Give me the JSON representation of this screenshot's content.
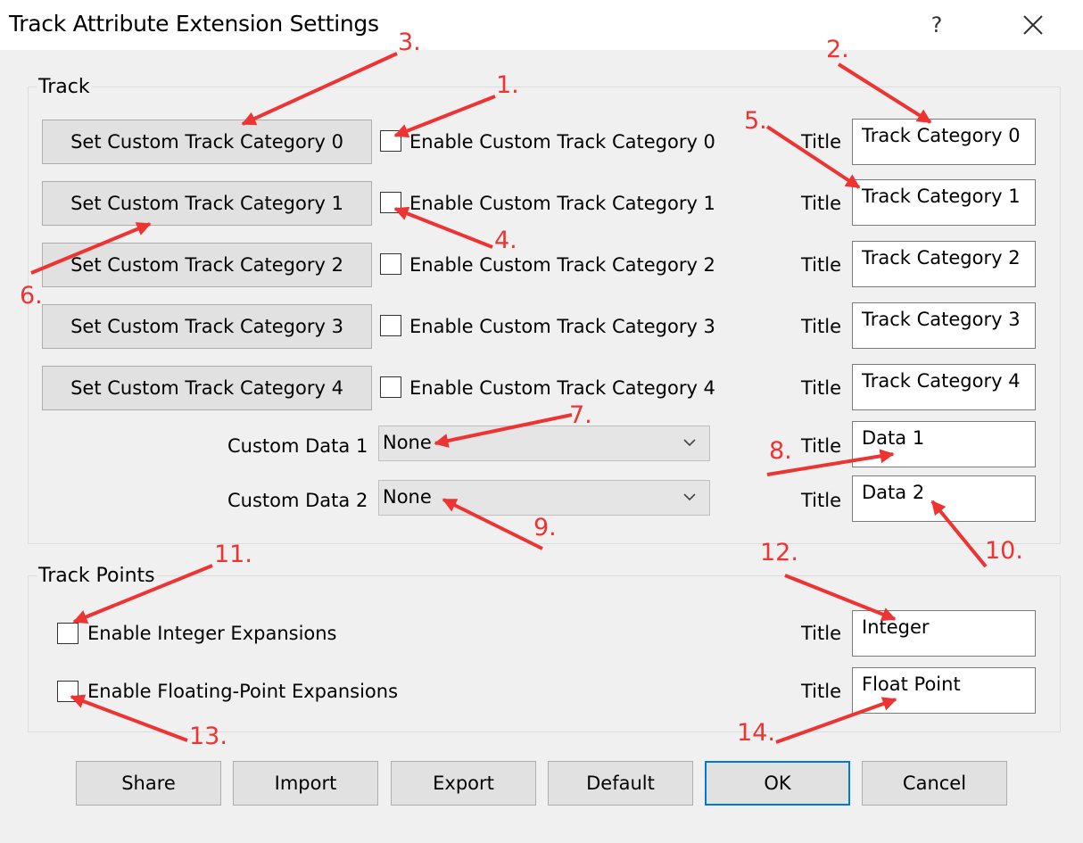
{
  "window": {
    "title": "Track Attribute Extension Settings",
    "help": "?"
  },
  "track": {
    "group_label": "Track",
    "rows": [
      {
        "button": "Set Custom Track Category 0",
        "enable": "Enable Custom Track Category 0",
        "title_label": "Title",
        "title_value": "Track Category 0"
      },
      {
        "button": "Set Custom Track Category 1",
        "enable": "Enable Custom Track Category 1",
        "title_label": "Title",
        "title_value": "Track Category 1"
      },
      {
        "button": "Set Custom Track Category 2",
        "enable": "Enable Custom Track Category 2",
        "title_label": "Title",
        "title_value": "Track Category 2"
      },
      {
        "button": "Set Custom Track Category 3",
        "enable": "Enable Custom Track Category 3",
        "title_label": "Title",
        "title_value": "Track Category 3"
      },
      {
        "button": "Set Custom Track Category 4",
        "enable": "Enable Custom Track Category 4",
        "title_label": "Title",
        "title_value": "Track Category 4"
      }
    ],
    "custom_data": [
      {
        "label": "Custom Data 1",
        "value": "None",
        "title_label": "Title",
        "title_value": "Data 1"
      },
      {
        "label": "Custom Data 2",
        "value": "None",
        "title_label": "Title",
        "title_value": "Data 2"
      }
    ]
  },
  "track_points": {
    "group_label": "Track Points",
    "integer": {
      "label": "Enable Integer Expansions",
      "title_label": "Title",
      "title_value": "Integer"
    },
    "float": {
      "label": "Enable Floating-Point Expansions",
      "title_label": "Title",
      "title_value": "Float Point"
    }
  },
  "footer": {
    "share": "Share",
    "import": "Import",
    "export": "Export",
    "default": "Default",
    "ok": "OK",
    "cancel": "Cancel"
  },
  "annotations": [
    "1.",
    "2.",
    "3.",
    "4.",
    "5.",
    "6.",
    "7.",
    "8.",
    "9.",
    "10.",
    "11.",
    "12.",
    "13.",
    "14."
  ],
  "colors": {
    "annotation": "#ee3333",
    "focus_border": "#0078d7",
    "button_bg": "#e1e1e1",
    "dialog_bg": "#f0f0f0"
  }
}
